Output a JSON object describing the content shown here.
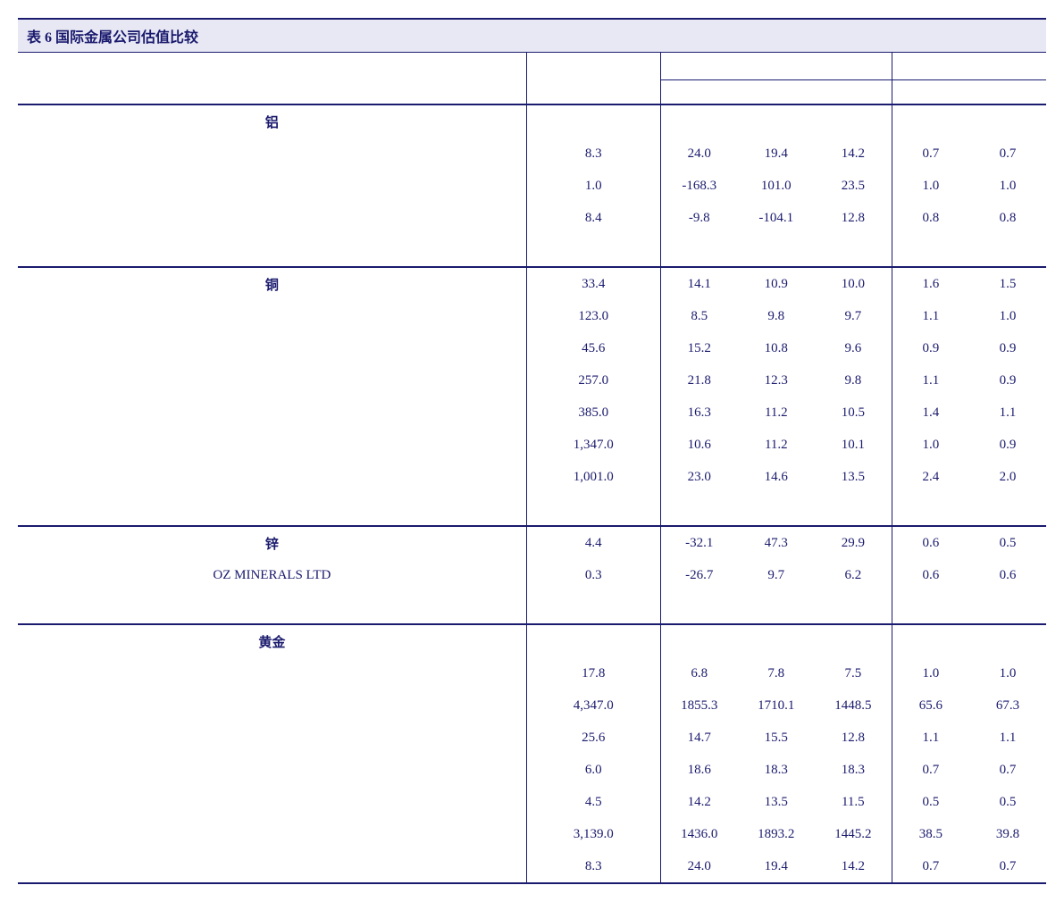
{
  "title": "表 6 国际金属公司估值比较",
  "sections": [
    {
      "label": "铝",
      "rows": [
        {
          "name": "",
          "price": "8.3",
          "pe": [
            "24.0",
            "19.4",
            "14.2"
          ],
          "pb": [
            "0.7",
            "0.7"
          ]
        },
        {
          "name": "",
          "price": "1.0",
          "pe": [
            "-168.3",
            "101.0",
            "23.5"
          ],
          "pb": [
            "1.0",
            "1.0"
          ]
        },
        {
          "name": "",
          "price": "8.4",
          "pe": [
            "-9.8",
            "-104.1",
            "12.8"
          ],
          "pb": [
            "0.8",
            "0.8"
          ]
        }
      ]
    },
    {
      "label": "铜",
      "rows": [
        {
          "name": "",
          "price": "33.4",
          "pe": [
            "14.1",
            "10.9",
            "10.0"
          ],
          "pb": [
            "1.6",
            "1.5"
          ]
        },
        {
          "name": "",
          "price": "123.0",
          "pe": [
            "8.5",
            "9.8",
            "9.7"
          ],
          "pb": [
            "1.1",
            "1.0"
          ]
        },
        {
          "name": "",
          "price": "45.6",
          "pe": [
            "15.2",
            "10.8",
            "9.6"
          ],
          "pb": [
            "0.9",
            "0.9"
          ]
        },
        {
          "name": "",
          "price": "257.0",
          "pe": [
            "21.8",
            "12.3",
            "9.8"
          ],
          "pb": [
            "1.1",
            "0.9"
          ]
        },
        {
          "name": "",
          "price": "385.0",
          "pe": [
            "16.3",
            "11.2",
            "10.5"
          ],
          "pb": [
            "1.4",
            "1.1"
          ]
        },
        {
          "name": "",
          "price": "1,347.0",
          "pe": [
            "10.6",
            "11.2",
            "10.1"
          ],
          "pb": [
            "1.0",
            "0.9"
          ]
        },
        {
          "name": "",
          "price": "1,001.0",
          "pe": [
            "23.0",
            "14.6",
            "13.5"
          ],
          "pb": [
            "2.4",
            "2.0"
          ]
        }
      ]
    },
    {
      "label": "锌",
      "rows": [
        {
          "name": "",
          "price": "4.4",
          "pe": [
            "-32.1",
            "47.3",
            "29.9"
          ],
          "pb": [
            "0.6",
            "0.5"
          ]
        },
        {
          "name": "OZ MINERALS LTD",
          "visible": true,
          "price": "0.3",
          "pe": [
            "-26.7",
            "9.7",
            "6.2"
          ],
          "pb": [
            "0.6",
            "0.6"
          ]
        }
      ]
    },
    {
      "label": "黄金",
      "rows": [
        {
          "name": "",
          "price": "17.8",
          "pe": [
            "6.8",
            "7.8",
            "7.5"
          ],
          "pb": [
            "1.0",
            "1.0"
          ]
        },
        {
          "name": "",
          "price": "4,347.0",
          "pe": [
            "1855.3",
            "1710.1",
            "1448.5"
          ],
          "pb": [
            "65.6",
            "67.3"
          ]
        },
        {
          "name": "",
          "price": "25.6",
          "pe": [
            "14.7",
            "15.5",
            "12.8"
          ],
          "pb": [
            "1.1",
            "1.1"
          ]
        },
        {
          "name": "",
          "price": "6.0",
          "pe": [
            "18.6",
            "18.3",
            "18.3"
          ],
          "pb": [
            "0.7",
            "0.7"
          ]
        },
        {
          "name": "",
          "price": "4.5",
          "pe": [
            "14.2",
            "13.5",
            "11.5"
          ],
          "pb": [
            "0.5",
            "0.5"
          ]
        },
        {
          "name": "",
          "price": "3,139.0",
          "pe": [
            "1436.0",
            "1893.2",
            "1445.2"
          ],
          "pb": [
            "38.5",
            "39.8"
          ]
        },
        {
          "name": "",
          "price": "8.3",
          "pe": [
            "24.0",
            "19.4",
            "14.2"
          ],
          "pb": [
            "0.7",
            "0.7"
          ]
        }
      ]
    }
  ]
}
